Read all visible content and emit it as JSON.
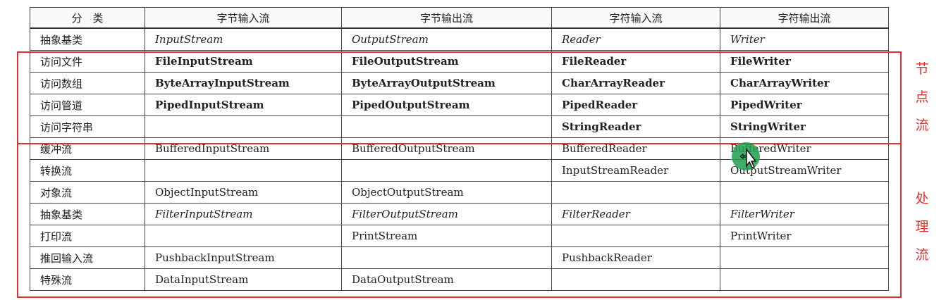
{
  "table": {
    "headers": [
      "分　类",
      "字节输入流",
      "字节输出流",
      "字符输入流",
      "字符输出流"
    ],
    "rows": [
      {
        "category": "抽象基类",
        "style": "i",
        "cells": [
          "InputStream",
          "OutputStream",
          "Reader",
          "Writer"
        ]
      },
      {
        "category": "访问文件",
        "style": "b",
        "cells": [
          "FileInputStream",
          "FileOutputStream",
          "FileReader",
          "FileWriter"
        ]
      },
      {
        "category": "访问数组",
        "style": "b",
        "cells": [
          "ByteArrayInputStream",
          "ByteArrayOutputStream",
          "CharArrayReader",
          "CharArrayWriter"
        ]
      },
      {
        "category": "访问管道",
        "style": "b",
        "cells": [
          "PipedInputStream",
          "PipedOutputStream",
          "PipedReader",
          "PipedWriter"
        ]
      },
      {
        "category": "访问字符串",
        "style": "b",
        "cells": [
          "",
          "",
          "StringReader",
          "StringWriter"
        ]
      },
      {
        "category": "缓冲流",
        "style": "n",
        "cells": [
          "BufferedInputStream",
          "BufferedOutputStream",
          "BufferedReader",
          "BufferedWriter"
        ]
      },
      {
        "category": "转换流",
        "style": "n",
        "cells": [
          "",
          "",
          "InputStreamReader",
          "OutputStreamWriter"
        ]
      },
      {
        "category": "对象流",
        "style": "n",
        "cells": [
          "ObjectInputStream",
          "ObjectOutputStream",
          "",
          ""
        ]
      },
      {
        "category": "抽象基类",
        "style": "i",
        "cells": [
          "FilterInputStream",
          "FilterOutputStream",
          "FilterReader",
          "FilterWriter"
        ]
      },
      {
        "category": "打印流",
        "style": "n",
        "cells": [
          "",
          "PrintStream",
          "",
          "PrintWriter"
        ]
      },
      {
        "category": "推回输入流",
        "style": "n",
        "cells": [
          "PushbackInputStream",
          "",
          "PushbackReader",
          ""
        ]
      },
      {
        "category": "特殊流",
        "style": "n",
        "cells": [
          "DataInputStream",
          "DataOutputStream",
          "",
          ""
        ]
      }
    ]
  },
  "annotations": {
    "node_stream_label": [
      "节",
      "点",
      "流"
    ],
    "processing_stream_label": [
      "处",
      "理",
      "流"
    ],
    "highlight_color": "#e3312f"
  },
  "cursor": {
    "icon": "move-cursor-icon",
    "color": "#1ea050"
  }
}
